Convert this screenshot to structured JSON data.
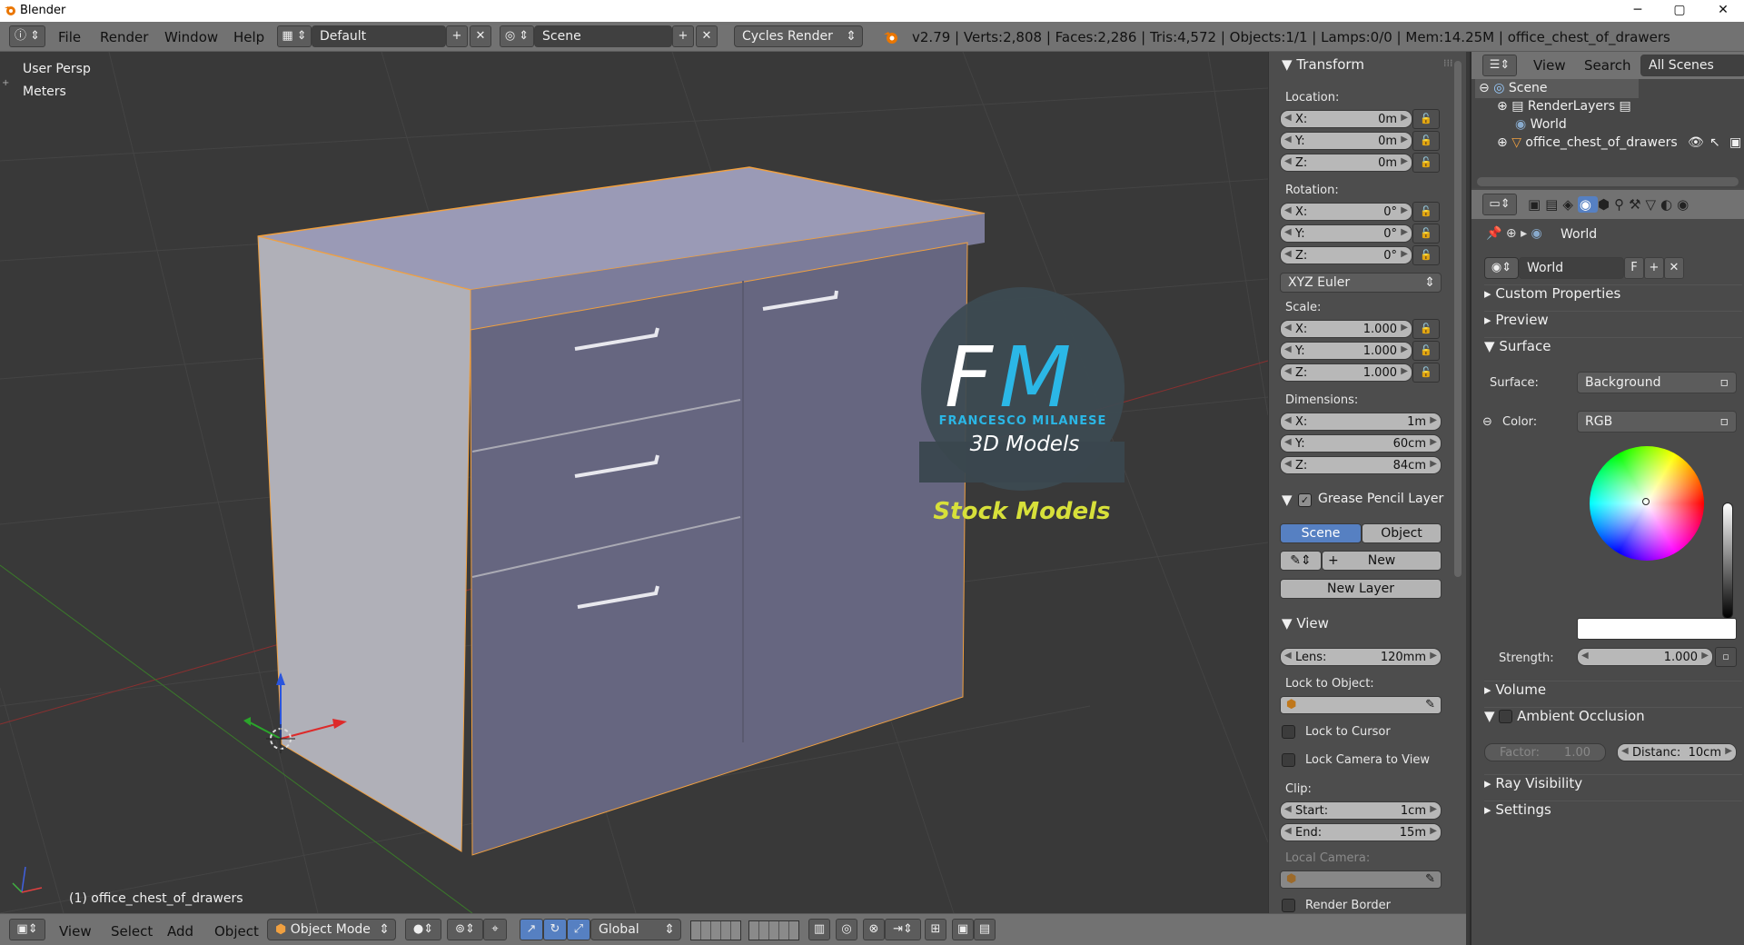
{
  "window": {
    "title": "Blender",
    "minimize": "─",
    "maximize": "▢",
    "close": "✕"
  },
  "info_header": {
    "menus": [
      "File",
      "Render",
      "Window",
      "Help"
    ],
    "layout": "Default",
    "scene": "Scene",
    "engine": "Cycles Render",
    "stats": "v2.79 | Verts:2,808 | Faces:2,286 | Tris:4,572 | Objects:1/1 | Lamps:0/0 | Mem:14.25M | office_chest_of_drawers"
  },
  "viewport": {
    "view_name": "User Persp",
    "units": "Meters",
    "object_label": "(1) office_chest_of_drawers",
    "watermark": {
      "initials_f": "F",
      "initials_m": "M",
      "brand": "FRANCESCO MILANESE",
      "subtitle": "3D Models",
      "banner": "Stock Models"
    }
  },
  "npanel": {
    "transform_title": "Transform",
    "location_label": "Location:",
    "location": [
      {
        "k": "X:",
        "v": "0m"
      },
      {
        "k": "Y:",
        "v": "0m"
      },
      {
        "k": "Z:",
        "v": "0m"
      }
    ],
    "rotation_label": "Rotation:",
    "rotation": [
      {
        "k": "X:",
        "v": "0°"
      },
      {
        "k": "Y:",
        "v": "0°"
      },
      {
        "k": "Z:",
        "v": "0°"
      }
    ],
    "rotation_mode": "XYZ Euler",
    "scale_label": "Scale:",
    "scale": [
      {
        "k": "X:",
        "v": "1.000"
      },
      {
        "k": "Y:",
        "v": "1.000"
      },
      {
        "k": "Z:",
        "v": "1.000"
      }
    ],
    "dimensions_label": "Dimensions:",
    "dimensions": [
      {
        "k": "X:",
        "v": "1m"
      },
      {
        "k": "Y:",
        "v": "60cm"
      },
      {
        "k": "Z:",
        "v": "84cm"
      }
    ],
    "grease_title": "Grease Pencil Layer",
    "grease_scene": "Scene",
    "grease_object": "Object",
    "grease_new": "New",
    "grease_new_layer": "New Layer",
    "view_title": "View",
    "lens_label": "Lens:",
    "lens_value": "120mm",
    "lock_to_object": "Lock to Object:",
    "lock_to_cursor": "Lock to Cursor",
    "lock_camera": "Lock Camera to View",
    "clip_label": "Clip:",
    "clip_start_label": "Start:",
    "clip_start": "1cm",
    "clip_end_label": "End:",
    "clip_end": "15m",
    "local_camera": "Local Camera:",
    "render_border": "Render Border"
  },
  "outliner": {
    "menus": [
      "View",
      "Search"
    ],
    "filter": "All Scenes",
    "items": [
      "Scene",
      "RenderLayers",
      "World",
      "office_chest_of_drawers"
    ]
  },
  "properties": {
    "breadcrumb": "World",
    "world_name": "World",
    "fake_user": "F",
    "panels": {
      "custom": "Custom Properties",
      "preview": "Preview",
      "surface": "Surface",
      "volume": "Volume",
      "ao": "Ambient Occlusion",
      "ray": "Ray Visibility",
      "settings": "Settings"
    },
    "surface_label": "Surface:",
    "surface_value": "Background",
    "color_label": "Color:",
    "color_mode": "RGB",
    "strength_label": "Strength:",
    "strength_value": "1.000",
    "factor_label": "Factor:",
    "factor_value": "1.00",
    "distance_label": "Distanc:",
    "distance_value": "10cm"
  },
  "footer": {
    "menus": [
      "View",
      "Select",
      "Add",
      "Object"
    ],
    "mode": "Object Mode",
    "orientation": "Global"
  }
}
